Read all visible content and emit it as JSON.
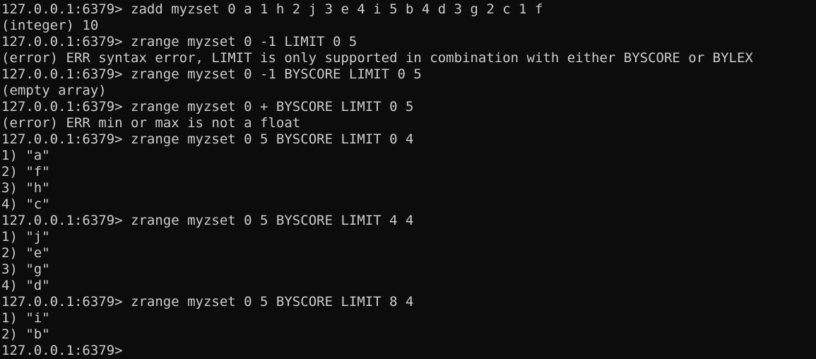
{
  "terminal": {
    "prompt": "127.0.0.1:6379> ",
    "lines": [
      {
        "type": "cmd",
        "text": "zadd myzset 0 a 1 h 2 j 3 e 4 i 5 b 4 d 3 g 2 c 1 f"
      },
      {
        "type": "out",
        "text": "(integer) 10"
      },
      {
        "type": "cmd",
        "text": "zrange myzset 0 -1 LIMIT 0 5"
      },
      {
        "type": "out",
        "text": "(error) ERR syntax error, LIMIT is only supported in combination with either BYSCORE or BYLEX"
      },
      {
        "type": "cmd",
        "text": "zrange myzset 0 -1 BYSCORE LIMIT 0 5"
      },
      {
        "type": "out",
        "text": "(empty array)"
      },
      {
        "type": "cmd",
        "text": "zrange myzset 0 + BYSCORE LIMIT 0 5"
      },
      {
        "type": "out",
        "text": "(error) ERR min or max is not a float"
      },
      {
        "type": "cmd",
        "text": "zrange myzset 0 5 BYSCORE LIMIT 0 4"
      },
      {
        "type": "out",
        "text": "1) \"a\""
      },
      {
        "type": "out",
        "text": "2) \"f\""
      },
      {
        "type": "out",
        "text": "3) \"h\""
      },
      {
        "type": "out",
        "text": "4) \"c\""
      },
      {
        "type": "cmd",
        "text": "zrange myzset 0 5 BYSCORE LIMIT 4 4"
      },
      {
        "type": "out",
        "text": "1) \"j\""
      },
      {
        "type": "out",
        "text": "2) \"e\""
      },
      {
        "type": "out",
        "text": "3) \"g\""
      },
      {
        "type": "out",
        "text": "4) \"d\""
      },
      {
        "type": "cmd",
        "text": "zrange myzset 0 5 BYSCORE LIMIT 8 4"
      },
      {
        "type": "out",
        "text": "1) \"i\""
      },
      {
        "type": "out",
        "text": "2) \"b\""
      },
      {
        "type": "prompt",
        "text": ""
      }
    ]
  }
}
